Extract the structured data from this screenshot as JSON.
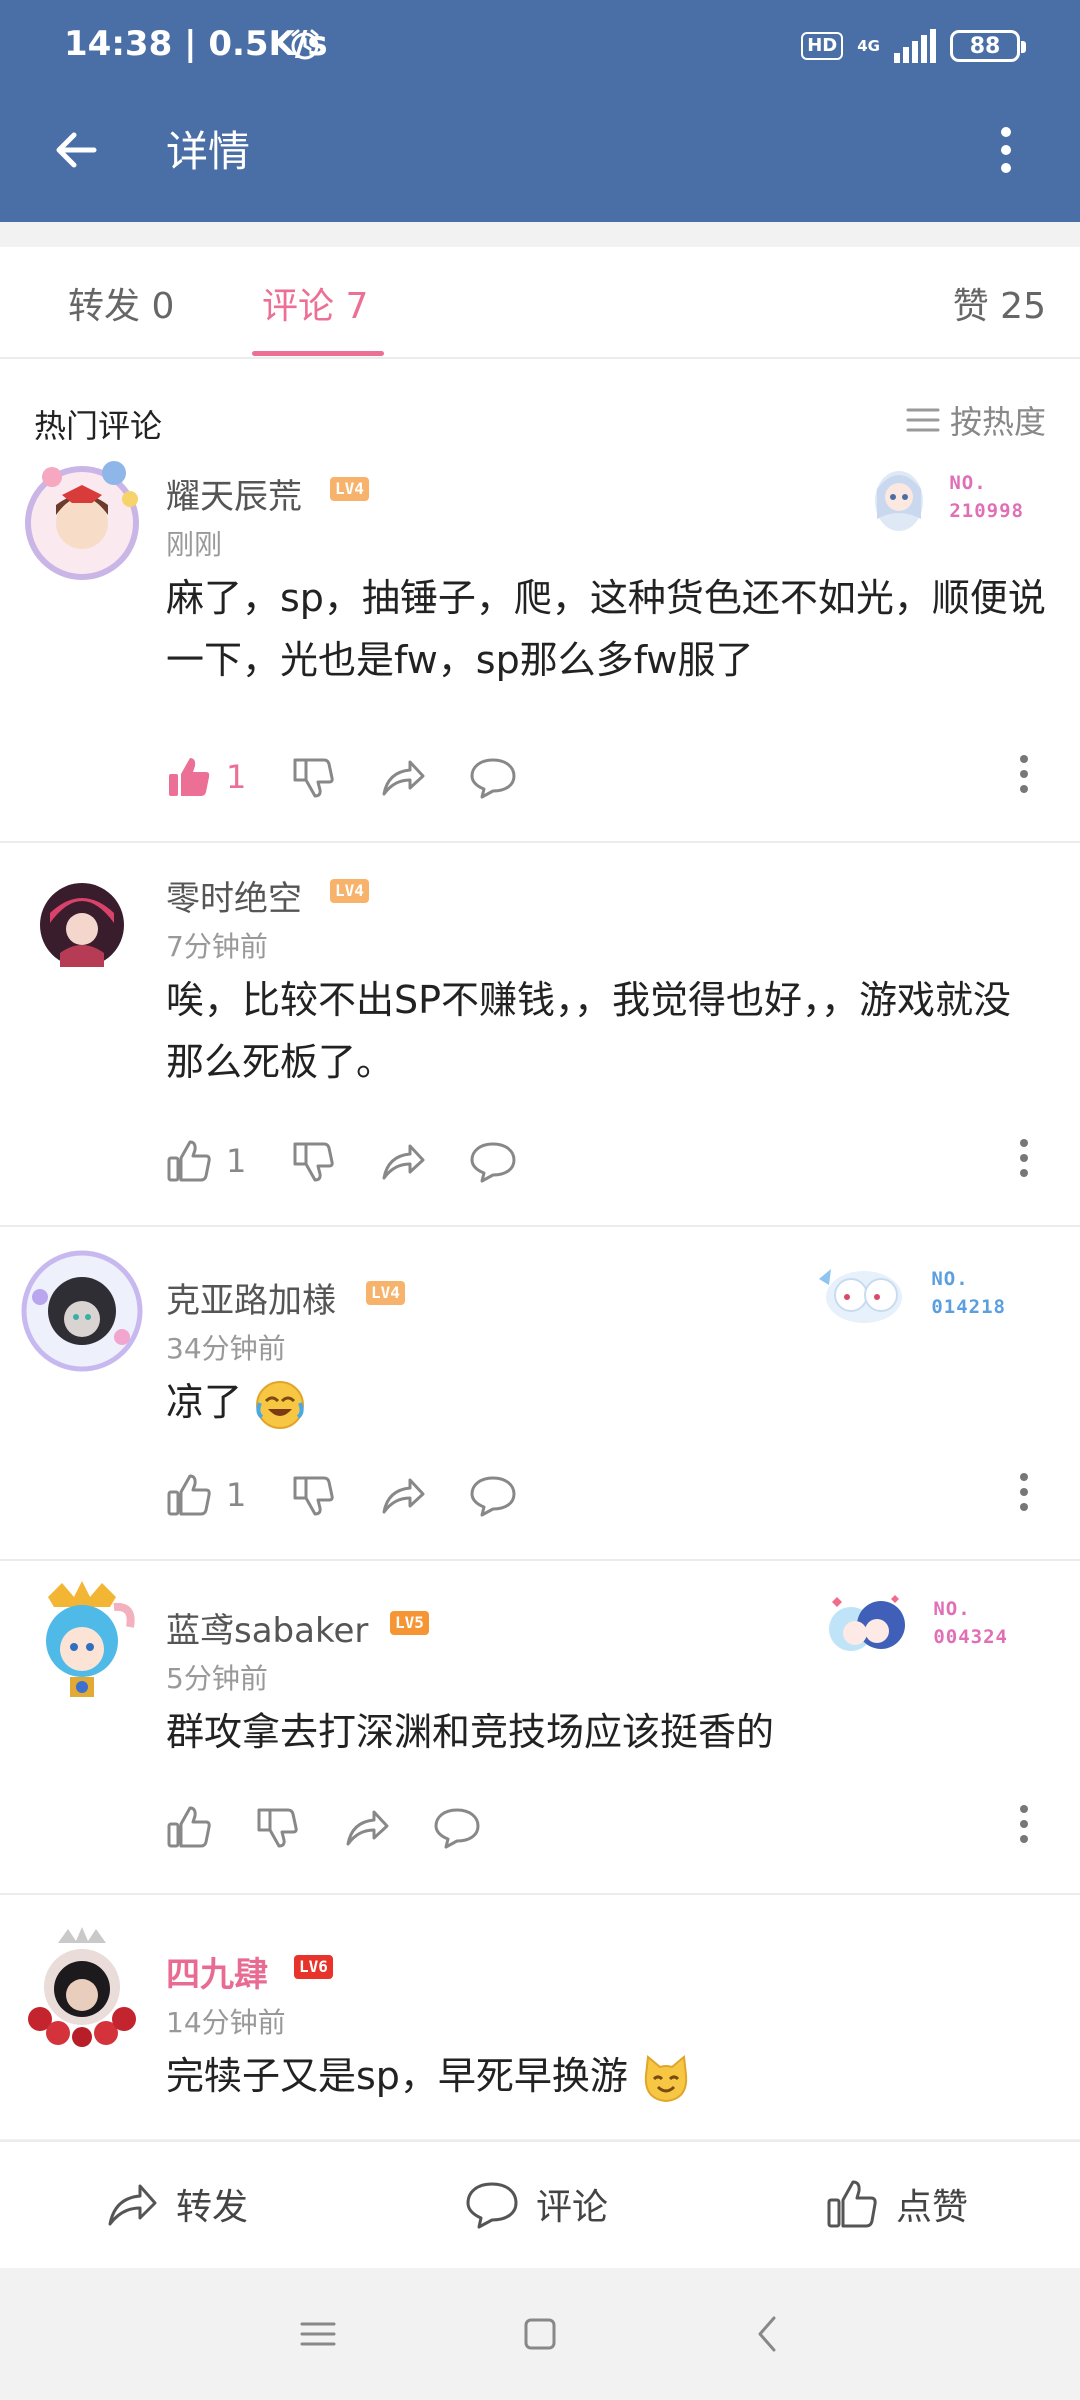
{
  "status_bar": {
    "time": "14:38 | 0.5K/s",
    "hd": "HD",
    "network": "4G",
    "battery": "88"
  },
  "app_bar": {
    "title": "详情"
  },
  "tabs": {
    "repost": "转发 0",
    "comments": "评论 7",
    "likes": "赞 25"
  },
  "section": {
    "title": "热门评论",
    "sort_label": "按热度"
  },
  "comments": [
    {
      "user": "耀天辰荒",
      "level": "LV4",
      "time": "刚刚",
      "text": "麻了，sp，抽锤子，爬，这种货色还不如光，顺便说一下，光也是fw，sp那么多fw服了",
      "likes": "1",
      "liked": true,
      "badge": {
        "no": "NO.",
        "code": "210998",
        "color": "#e06fb6"
      }
    },
    {
      "user": "零时绝空",
      "level": "LV4",
      "time": "7分钟前",
      "text": "唉，比较不出SP不赚钱，，我觉得也好，，游戏就没那么死板了。",
      "likes": "1",
      "liked": false
    },
    {
      "user": "克亚路加様",
      "level": "LV4",
      "time": "34分钟前",
      "text": "凉了",
      "likes": "1",
      "liked": false,
      "badge": {
        "no": "NO.",
        "code": "014218",
        "color": "#5b9fe0"
      }
    },
    {
      "user": "蓝鸢sabaker",
      "level": "LV5",
      "time": "5分钟前",
      "text": "群攻拿去打深渊和竞技场应该挺香的",
      "likes": "",
      "liked": false,
      "badge": {
        "no": "NO.",
        "code": "004324",
        "color": "#e06fb6"
      }
    },
    {
      "user": "四九肆",
      "level": "LV6",
      "time": "14分钟前",
      "text": "完犊子又是sp，早死早换游"
    }
  ],
  "bottom_bar": {
    "repost": "转发",
    "comment": "评论",
    "like": "点赞"
  },
  "colors": {
    "app_bar": "#4a6fa7",
    "accent_pink": "#ec6f95"
  }
}
